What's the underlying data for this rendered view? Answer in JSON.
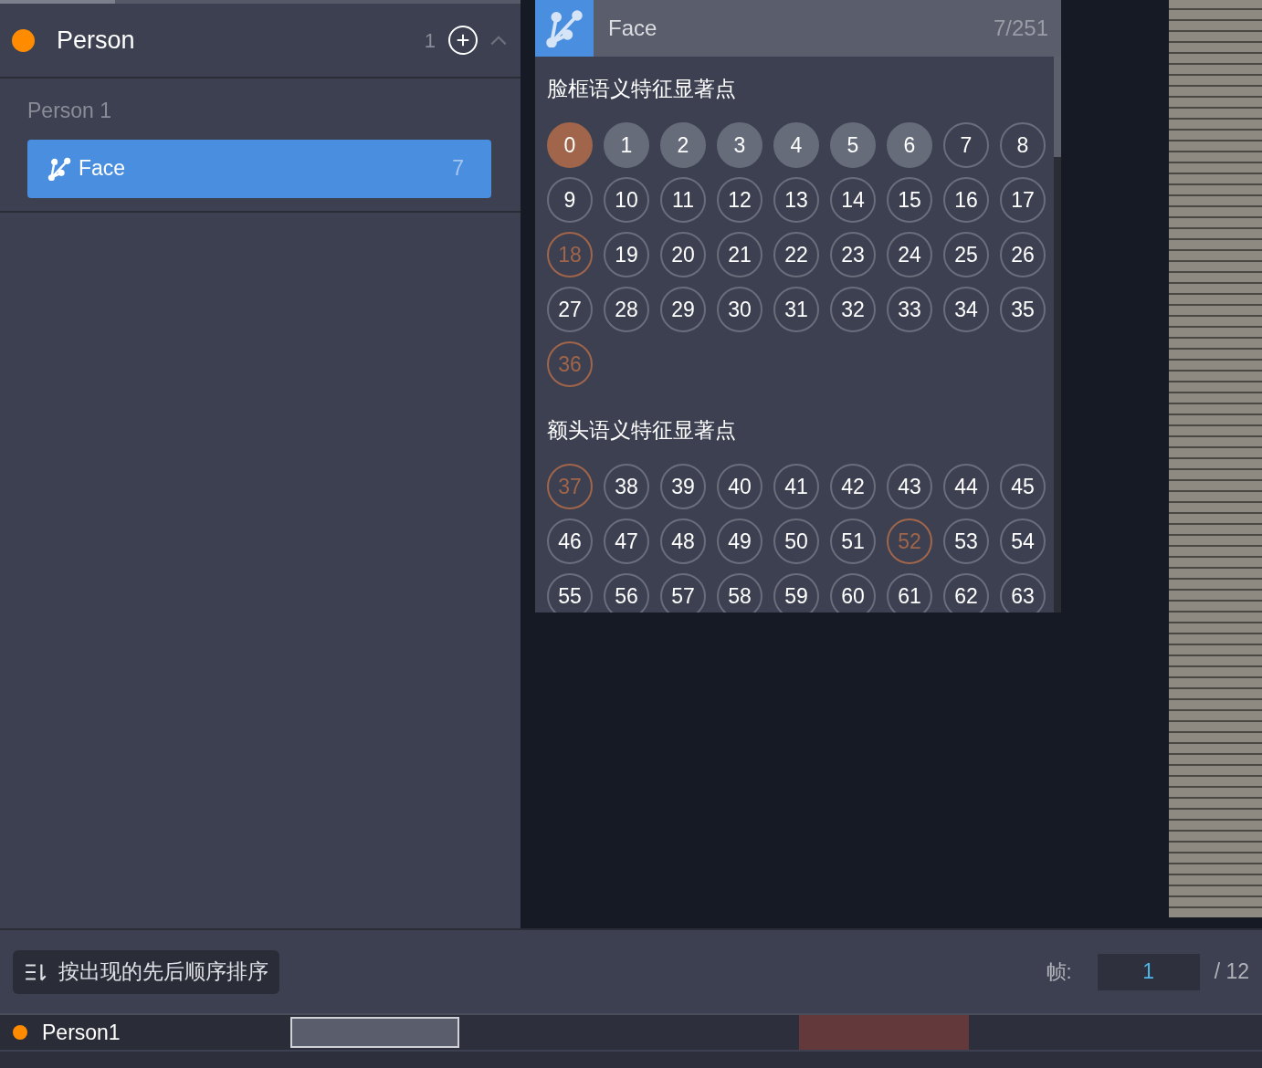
{
  "group": {
    "name": "Person",
    "color": "#ff8c00",
    "count": "1",
    "expanded": true
  },
  "instance": {
    "name": "Person 1",
    "items": [
      {
        "label": "Face",
        "count": "7",
        "selected": true
      }
    ]
  },
  "popup": {
    "title": "Face",
    "progress": "7/251",
    "sections": [
      {
        "title": "脸框语义特征显著点",
        "points": [
          {
            "label": "0",
            "kind": "current"
          },
          {
            "label": "1",
            "kind": "done"
          },
          {
            "label": "2",
            "kind": "done"
          },
          {
            "label": "3",
            "kind": "done"
          },
          {
            "label": "4",
            "kind": "done"
          },
          {
            "label": "5",
            "kind": "done"
          },
          {
            "label": "6",
            "kind": "done"
          },
          {
            "label": "7",
            "kind": "pending"
          },
          {
            "label": "8",
            "kind": "pending"
          },
          {
            "label": "9",
            "kind": "pending"
          },
          {
            "label": "10",
            "kind": "pending"
          },
          {
            "label": "11",
            "kind": "pending"
          },
          {
            "label": "12",
            "kind": "pending"
          },
          {
            "label": "13",
            "kind": "pending"
          },
          {
            "label": "14",
            "kind": "pending"
          },
          {
            "label": "15",
            "kind": "pending"
          },
          {
            "label": "16",
            "kind": "pending"
          },
          {
            "label": "17",
            "kind": "pending"
          },
          {
            "label": "18",
            "kind": "flagged"
          },
          {
            "label": "19",
            "kind": "pending"
          },
          {
            "label": "20",
            "kind": "pending"
          },
          {
            "label": "21",
            "kind": "pending"
          },
          {
            "label": "22",
            "kind": "pending"
          },
          {
            "label": "23",
            "kind": "pending"
          },
          {
            "label": "24",
            "kind": "pending"
          },
          {
            "label": "25",
            "kind": "pending"
          },
          {
            "label": "26",
            "kind": "pending"
          },
          {
            "label": "27",
            "kind": "pending"
          },
          {
            "label": "28",
            "kind": "pending"
          },
          {
            "label": "29",
            "kind": "pending"
          },
          {
            "label": "30",
            "kind": "pending"
          },
          {
            "label": "31",
            "kind": "pending"
          },
          {
            "label": "32",
            "kind": "pending"
          },
          {
            "label": "33",
            "kind": "pending"
          },
          {
            "label": "34",
            "kind": "pending"
          },
          {
            "label": "35",
            "kind": "pending"
          },
          {
            "label": "36",
            "kind": "flagged"
          }
        ]
      },
      {
        "title": "额头语义特征显著点",
        "points": [
          {
            "label": "37",
            "kind": "flagged"
          },
          {
            "label": "38",
            "kind": "pending"
          },
          {
            "label": "39",
            "kind": "pending"
          },
          {
            "label": "40",
            "kind": "pending"
          },
          {
            "label": "41",
            "kind": "pending"
          },
          {
            "label": "42",
            "kind": "pending"
          },
          {
            "label": "43",
            "kind": "pending"
          },
          {
            "label": "44",
            "kind": "pending"
          },
          {
            "label": "45",
            "kind": "pending"
          },
          {
            "label": "46",
            "kind": "pending"
          },
          {
            "label": "47",
            "kind": "pending"
          },
          {
            "label": "48",
            "kind": "pending"
          },
          {
            "label": "49",
            "kind": "pending"
          },
          {
            "label": "50",
            "kind": "pending"
          },
          {
            "label": "51",
            "kind": "pending"
          },
          {
            "label": "52",
            "kind": "flagged"
          },
          {
            "label": "53",
            "kind": "pending"
          },
          {
            "label": "54",
            "kind": "pending"
          },
          {
            "label": "55",
            "kind": "pending"
          },
          {
            "label": "56",
            "kind": "pending"
          },
          {
            "label": "57",
            "kind": "pending"
          },
          {
            "label": "58",
            "kind": "pending"
          },
          {
            "label": "59",
            "kind": "pending"
          },
          {
            "label": "60",
            "kind": "pending"
          },
          {
            "label": "61",
            "kind": "pending"
          },
          {
            "label": "62",
            "kind": "pending"
          },
          {
            "label": "63",
            "kind": "pending"
          }
        ]
      }
    ]
  },
  "bottom_bar": {
    "sort_button": "按出现的先后顺序排序",
    "frame_label": "帧:",
    "frame_value": "1",
    "frame_total": "/ 12"
  },
  "timeline": {
    "rows": [
      {
        "name": "Person1",
        "color": "#ff8c00"
      }
    ]
  }
}
